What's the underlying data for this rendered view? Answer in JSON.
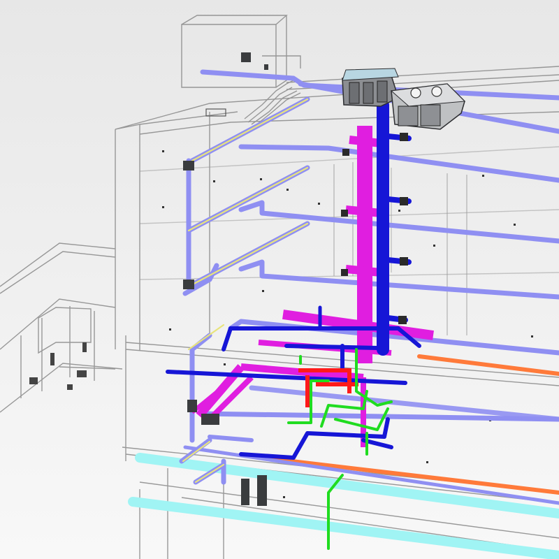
{
  "view": {
    "type": "3D BIM MEP coordination model (no visible text)"
  },
  "colors": {
    "background_top": "#e6e6e6",
    "background_bottom": "#f7f7f7",
    "building_lines": "#9a9a9a",
    "lavender_pipe": "#8f8ff2",
    "yellow_stripe": "#e7e27a",
    "magenta_duct": "#e21ee0",
    "blue_duct": "#1616d8",
    "red_pipe": "#ff1a1a",
    "green_pipe": "#22dd22",
    "cyan_pipe": "#9ff3f3",
    "orange_pipe": "#ff7a3a",
    "equipment_gray": "#8c8e92",
    "equipment_dark": "#303234"
  },
  "legend_semantics": {
    "pipes": [
      "lavender",
      "yellow",
      "magenta",
      "blue",
      "red",
      "green",
      "cyan",
      "orange"
    ],
    "equipment": [
      "rooftop-unit",
      "condenser-unit",
      "wall-unit"
    ]
  }
}
